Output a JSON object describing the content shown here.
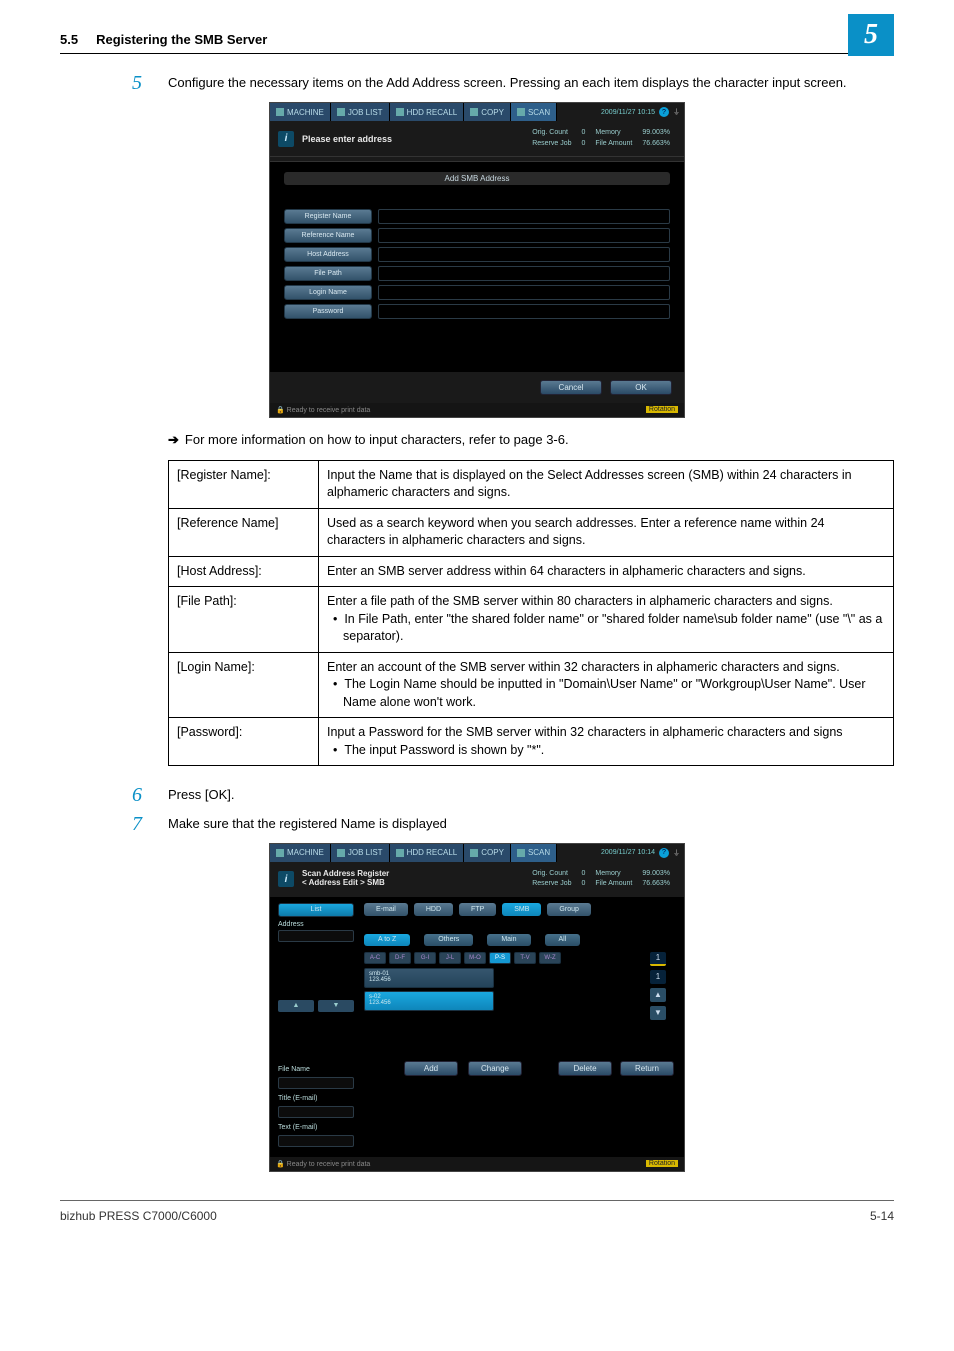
{
  "header": {
    "sec_num": "5.5",
    "title": "Registering the SMB Server",
    "badge": "5"
  },
  "step5": {
    "num": "5",
    "text": "Configure the necessary items on the Add Address screen.  Pressing an each item displays the character input screen."
  },
  "ss1": {
    "tabs": {
      "machine": "MACHINE",
      "joblist": "JOB LIST",
      "hddrecall": "HDD RECALL",
      "copy": "COPY",
      "scan": "SCAN"
    },
    "clock": "2009/11/27 10:15",
    "prompt": "Please enter address",
    "stats": {
      "orig": "Orig. Count",
      "origv": "0",
      "res": "Reserve Job",
      "resv": "0",
      "mem": "Memory",
      "memv": "99.003%",
      "fa": "File Amount",
      "fav": "76.663%"
    },
    "title": "Add SMB Address",
    "fields": {
      "reg": "Register Name",
      "ref": "Reference Name",
      "host": "Host Address",
      "fp": "File Path",
      "login": "Login Name",
      "pw": "Password"
    },
    "cancel": "Cancel",
    "ok": "OK",
    "status": "Ready to receive print data",
    "rot": "Rotation"
  },
  "arrow1": "For more information on how to input characters, refer to page 3-6.",
  "table": {
    "r1k": "[Register Name]:",
    "r1v": "Input the Name that is displayed on the Select Addresses screen (SMB) within 24 characters in alphameric characters and signs.",
    "r2k": "[Reference Name]",
    "r2v": "Used as a search keyword when you search addresses.  Enter a reference name within 24 characters in alphameric characters and signs.",
    "r3k": "[Host Address]:",
    "r3v": "Enter an SMB server address within 64 characters in alphameric characters and signs.",
    "r4k": "[File Path]:",
    "r4v": "Enter a file path of the SMB server within 80 characters in alphameric characters and signs.",
    "r4b": "In File Path, enter \"the shared folder name\" or \"shared folder name\\sub folder name\" (use \"\\\" as a separator).",
    "r5k": "[Login Name]:",
    "r5v": "Enter an account of the SMB server within 32 characters in alphameric characters and signs.",
    "r5b": "The Login Name should be inputted in \"Domain\\User Name\" or \"Workgroup\\User Name\". User Name alone won't work.",
    "r6k": "[Password]:",
    "r6v": "Input a Password for the SMB server within 32 characters in alphameric characters and signs",
    "r6b": "The input Password is shown by \"*\"."
  },
  "step6": {
    "num": "6",
    "text": "Press [OK]."
  },
  "step7": {
    "num": "7",
    "text": "Make sure that the registered Name is displayed"
  },
  "ss2": {
    "clock": "2009/11/27 10:14",
    "crumb": "Scan Address Register\n< Address Edit > SMB",
    "left": {
      "list": "List",
      "address": "Address",
      "filename": "File Name",
      "titleem": "Title (E-mail)",
      "textem": "Text (E-mail)"
    },
    "tabs": {
      "email": "E-mail",
      "hdd": "HDD",
      "ftp": "FTP",
      "smb": "SMB",
      "group": "Group"
    },
    "filters": {
      "atoz": "A to Z",
      "others": "Others",
      "main": "Main",
      "all": "All"
    },
    "letters": [
      "A-C",
      "D-F",
      "G-I",
      "J-L",
      "M-O",
      "P-S",
      "T-V",
      "W-Z"
    ],
    "items": [
      {
        "name": "smb-01",
        "addr": "123.456"
      },
      {
        "name": "s-02",
        "addr": "123.456"
      }
    ],
    "side_count": "1",
    "actions": {
      "add": "Add",
      "change": "Change",
      "delete": "Delete",
      "return": "Return"
    }
  },
  "footer": {
    "left": "bizhub PRESS C7000/C6000",
    "right": "5-14"
  }
}
